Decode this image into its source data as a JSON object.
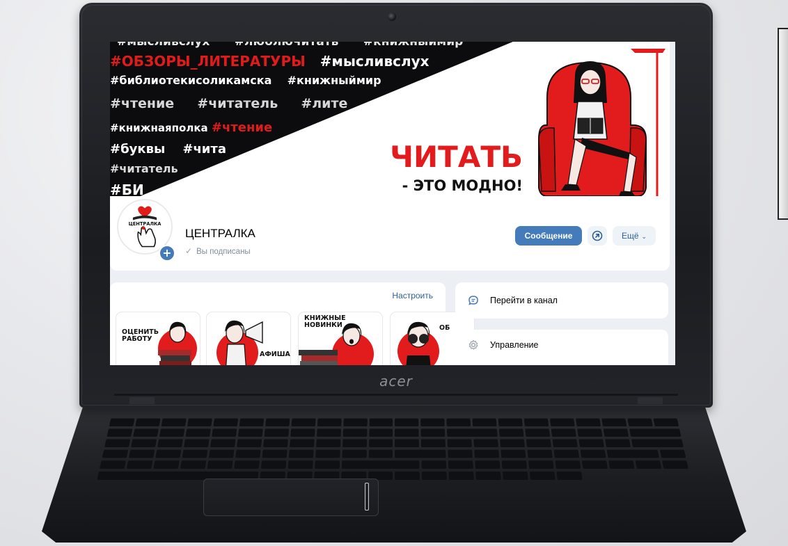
{
  "device": {
    "brand": "acer"
  },
  "cover": {
    "hashtags": [
      "#мысливслух",
      "#люблючитать",
      "#книжныймир",
      "#ОБЗОРЫ_ЛИТЕРАТУРЫ",
      "#мысливслух",
      "#библиотекисоликамска",
      "#книжныймир",
      "#чтение",
      "#читатель",
      "#лите",
      "#книжнаяполка",
      "#чтение",
      "#буквы",
      "#чита",
      "#читатель",
      "#БИ"
    ],
    "headline_line1": "ЧИТАТЬ",
    "headline_line2": "- ЭТО МОДНО!"
  },
  "community": {
    "avatar_label": "ЦЕНТРАЛКА",
    "name": "ЦЕНТРАЛКА",
    "subscription_status": "Вы подписаны",
    "message_button": "Сообщение",
    "more_button": "Ещё"
  },
  "widgets": {
    "configure_label": "Настроить",
    "tiles": [
      {
        "label_line1": "ОЦЕНИТЬ",
        "label_line2": "РАБОТУ"
      },
      {
        "label_line1": "АФИША",
        "label_line2": ""
      },
      {
        "label_line1": "КНИЖНЫЕ",
        "label_line2": "НОВИНКИ"
      },
      {
        "label_line1": "ОБ",
        "label_line2": ""
      }
    ]
  },
  "sidebar": {
    "channel_link": "Перейти в канал",
    "manage_link": "Управление"
  },
  "colors": {
    "accent_red": "#e21c1c",
    "vk_blue": "#447bba",
    "link_blue": "#2d5f97"
  }
}
